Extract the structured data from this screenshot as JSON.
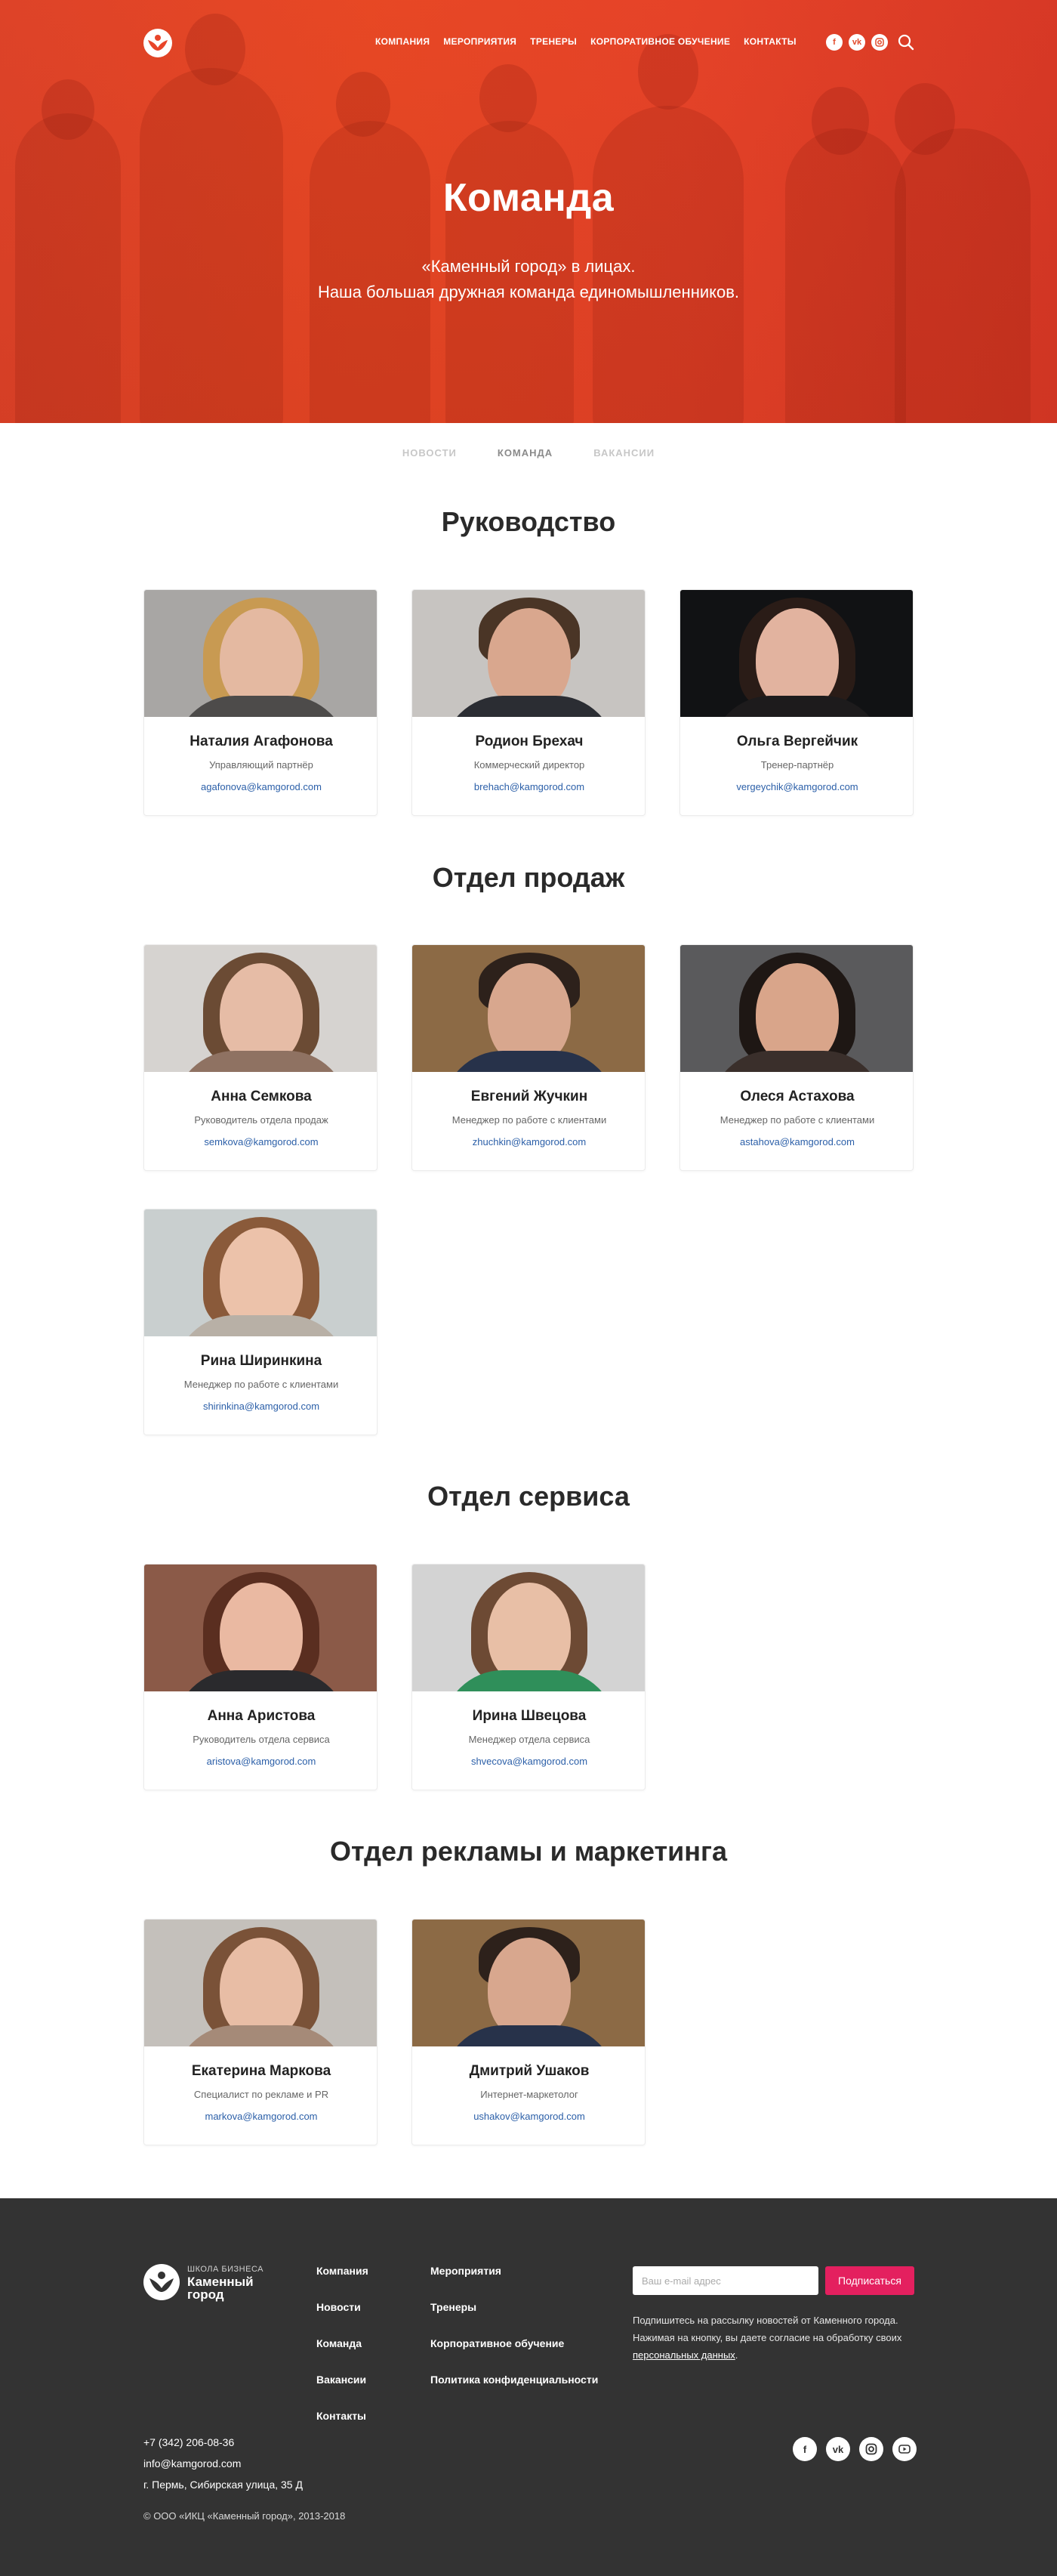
{
  "header": {
    "nav": [
      "Компания",
      "Мероприятия",
      "Тренеры",
      "Корпоративное обучение",
      "Контакты"
    ],
    "social_icons": [
      "facebook-icon",
      "vk-icon",
      "instagram-icon"
    ],
    "accent_color": "#e8452a"
  },
  "hero": {
    "title": "Команда",
    "subtitle_line1": "«Каменный город» в лицах.",
    "subtitle_line2": "Наша большая дружная команда единомышленников."
  },
  "tabs": [
    {
      "label": "Новости",
      "active": false
    },
    {
      "label": "Команда",
      "active": true
    },
    {
      "label": "Вакансии",
      "active": false
    }
  ],
  "sections": [
    {
      "title": "Руководство",
      "members": [
        {
          "name": "Наталия Агафонова",
          "role": "Управляющий партнёр",
          "email": "agafonova@kamgorod.com"
        },
        {
          "name": "Родион Брехач",
          "role": "Коммерческий директор",
          "email": "brehach@kamgorod.com"
        },
        {
          "name": "Ольга Вергейчик",
          "role": "Тренер-партнёр",
          "email": "vergeychik@kamgorod.com"
        }
      ]
    },
    {
      "title": "Отдел продаж",
      "members": [
        {
          "name": "Анна Семкова",
          "role": "Руководитель отдела продаж",
          "email": "semkova@kamgorod.com"
        },
        {
          "name": "Евгений Жучкин",
          "role": "Менеджер по работе с клиентами",
          "email": "zhuchkin@kamgorod.com"
        },
        {
          "name": "Олеся Астахова",
          "role": "Менеджер по работе с клиентами",
          "email": "astahova@kamgorod.com"
        },
        {
          "name": "Рина Ширинкина",
          "role": "Менеджер по работе с клиентами",
          "email": "shirinkina@kamgorod.com"
        }
      ]
    },
    {
      "title": "Отдел сервиса",
      "members": [
        {
          "name": "Анна Аристова",
          "role": "Руководитель отдела сервиса",
          "email": "aristova@kamgorod.com"
        },
        {
          "name": "Ирина Швецова",
          "role": "Менеджер отдела сервиса",
          "email": "shvecova@kamgorod.com"
        }
      ]
    },
    {
      "title": "Отдел рекламы и маркетинга",
      "members": [
        {
          "name": "Екатерина Маркова",
          "role": "Специалист по рекламе и PR",
          "email": "markova@kamgorod.com"
        },
        {
          "name": "Дмитрий Ушаков",
          "role": "Интернет-маркетолог",
          "email": "ushakov@kamgorod.com"
        }
      ]
    }
  ],
  "footer": {
    "logo_small": "Школа бизнеса",
    "logo_big": "Каменный город",
    "col1": [
      "Компания",
      "Новости",
      "Команда",
      "Вакансии",
      "Контакты"
    ],
    "col2": [
      "Мероприятия",
      "Тренеры",
      "Корпоративное обучение",
      "Политика конфиденциальности"
    ],
    "email_placeholder": "Ваш e-mail адрес",
    "subscribe_label": "Подписаться",
    "note_text": "Подпишитесь на рассылку новостей от Каменного города. Нажимая на кнопку, вы даете согласие на обработку своих",
    "note_link": "персональных данных",
    "phone": "+7 (342) 206-08-36",
    "email": "info@kamgorod.com",
    "address": "г. Пермь, Сибирская улица, 35 Д",
    "copyright": "© ООО «ИКЦ «Каменный город», 2013-2018",
    "social_icons": [
      "facebook-icon",
      "vk-icon",
      "instagram-icon",
      "youtube-icon"
    ],
    "subscribe_color": "#e4205f"
  }
}
